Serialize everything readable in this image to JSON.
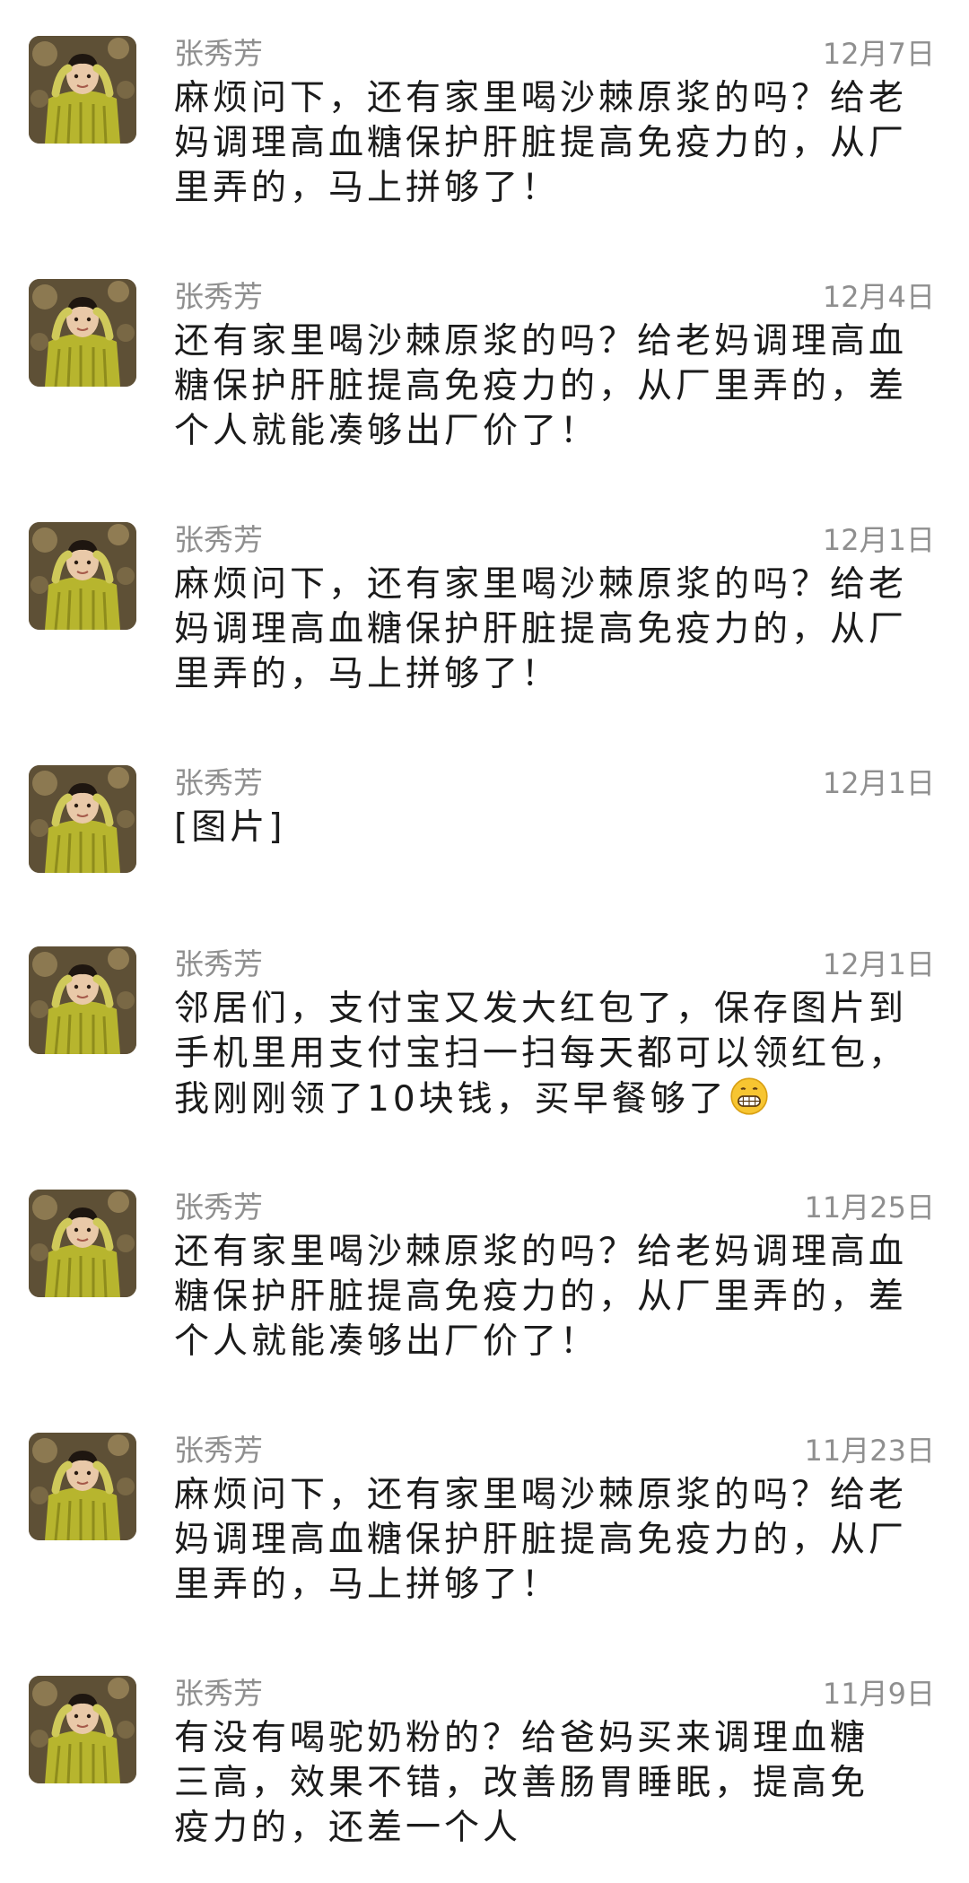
{
  "messages": [
    {
      "sender": "张秀芳",
      "date": "12月7日",
      "text": "麻烦问下，还有家里喝沙棘原浆的吗？给老妈调理高血糖保护肝脏提高免疫力的，从厂里弄的，马上拼够了！"
    },
    {
      "sender": "张秀芳",
      "date": "12月4日",
      "text": "还有家里喝沙棘原浆的吗？给老妈调理高血糖保护肝脏提高免疫力的，从厂里弄的，差个人就能凑够出厂价了！"
    },
    {
      "sender": "张秀芳",
      "date": "12月1日",
      "text": "麻烦问下，还有家里喝沙棘原浆的吗？给老妈调理高血糖保护肝脏提高免疫力的，从厂里弄的，马上拼够了！"
    },
    {
      "sender": "张秀芳",
      "date": "12月1日",
      "text": "[图片]"
    },
    {
      "sender": "张秀芳",
      "date": "12月1日",
      "text": "邻居们，支付宝又发大红包了，保存图片到手机里用支付宝扫一扫每天都可以领红包，我刚刚领了10块钱，买早餐够了",
      "emoji": "grinning-face-emoji"
    },
    {
      "sender": "张秀芳",
      "date": "11月25日",
      "text": "还有家里喝沙棘原浆的吗？给老妈调理高血糖保护肝脏提高免疫力的，从厂里弄的，差个人就能凑够出厂价了！"
    },
    {
      "sender": "张秀芳",
      "date": "11月23日",
      "text": "麻烦问下，还有家里喝沙棘原浆的吗？给老妈调理高血糖保护肝脏提高免疫力的，从厂里弄的，马上拼够了！"
    },
    {
      "sender": "张秀芳",
      "date": "11月9日",
      "text": "有没有喝驼奶粉的？给爸妈买来调理血糖三高，效果不错，改善肠胃睡眠，提高免疫力的，还差一个人"
    }
  ]
}
